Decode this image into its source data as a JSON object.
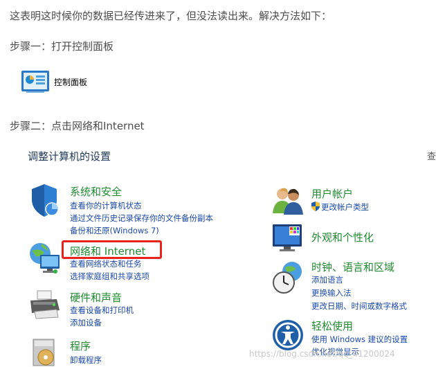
{
  "article": {
    "intro": "这表明这时候你的数据已经传进来了，但没法读出来。解决方法如下：",
    "step1": "步骤一：打开控制面板",
    "control_panel_label": "控制面板",
    "step2": "步骤二：点击网络和Internet"
  },
  "control_panel": {
    "title": "调整计算机的设置",
    "edge_text": "查",
    "left": [
      {
        "icon": "security-shield-icon",
        "title": "系统和安全",
        "links": [
          "查看你的计算机状态",
          "通过文件历史记录保存你的文件备份副本",
          "备份和还原(Windows 7)"
        ]
      },
      {
        "icon": "network-globe-icon",
        "title": "网络和 Internet",
        "links": [
          "查看网络状态和任务",
          "选择家庭组和共享选项"
        ]
      },
      {
        "icon": "printer-icon",
        "title": "硬件和声音",
        "links": [
          "查看设备和打印机",
          "添加设备"
        ]
      },
      {
        "icon": "programs-disc-icon",
        "title": "程序",
        "links": [
          "卸载程序"
        ]
      }
    ],
    "right": [
      {
        "icon": "users-icon",
        "title": "用户帐户",
        "links": [
          "更改帐户类型"
        ]
      },
      {
        "icon": "monitor-palette-icon",
        "title": "外观和个性化",
        "links": []
      },
      {
        "icon": "clock-globe-icon",
        "title": "时钟、语言和区域",
        "links": [
          "添加语言",
          "更换输入法",
          "更改日期、时间或数字格式"
        ]
      },
      {
        "icon": "ease-of-access-icon",
        "title": "轻松使用",
        "links": [
          "使用 Windows 建议的设置",
          "优化视觉显示"
        ]
      }
    ]
  },
  "watermark": "https://blog.csdn.net/qq_41200024",
  "colors": {
    "highlight": "#e8231c",
    "category_title": "#1e8b2e",
    "link": "#1a4aa8"
  }
}
